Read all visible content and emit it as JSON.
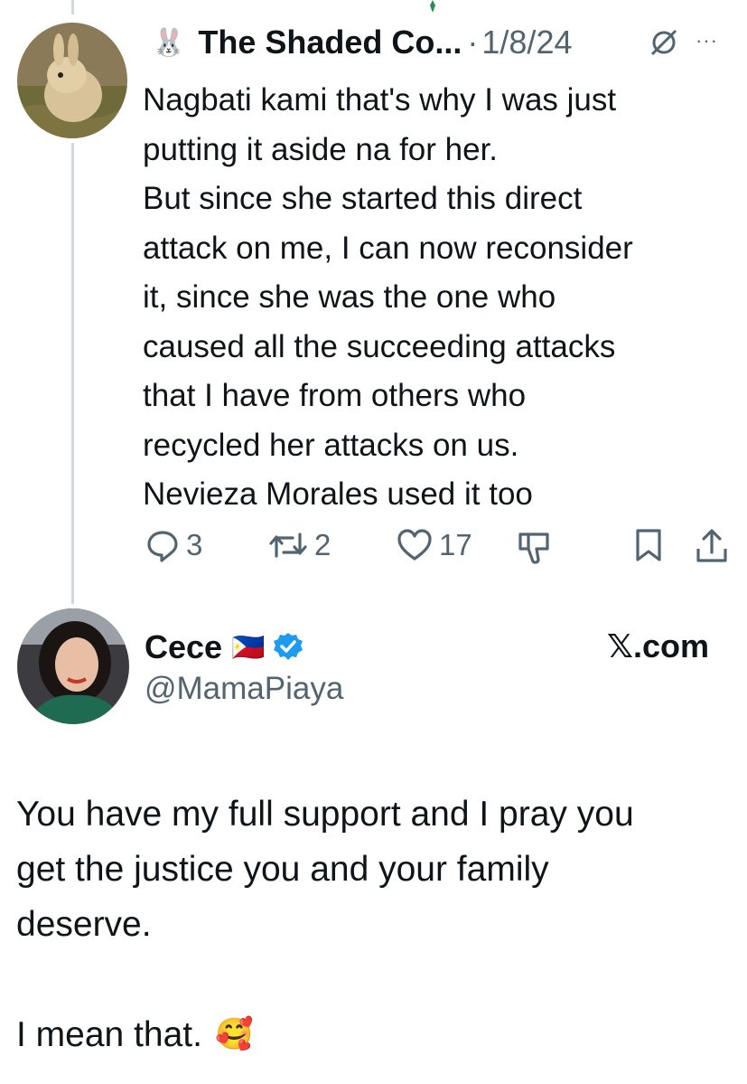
{
  "original_tweet": {
    "name_emoji": "🐰",
    "display_name": "The Shaded Co...",
    "separator": "·",
    "date": "1/8/24",
    "more_label": "···",
    "lines": [
      "Nagbati kami that's why I was just",
      "putting it aside na for her.",
      "But since she started this direct",
      "attack on me, I can now reconsider",
      "it, since she was the one who",
      "caused all the succeeding attacks",
      "that I have from others who",
      "recycled her attacks on us.",
      "Nevieza Morales used it too"
    ],
    "actions": {
      "reply_count": "3",
      "retweet_count": "2",
      "like_count": "17"
    }
  },
  "reply_tweet": {
    "display_name": "Cece",
    "flag": "🇵🇭",
    "handle": "@MamaPiaya",
    "source": "𝕏.com",
    "lines": [
      "You have my full support and I pray  you",
      "get the justice you and your family",
      "deserve.",
      "",
      "I mean that."
    ],
    "end_emoji": "🥰"
  },
  "colors": {
    "text": "#0f1419",
    "muted": "#536471",
    "verified": "#1d9bf0",
    "thread_line": "#cfd9de"
  }
}
